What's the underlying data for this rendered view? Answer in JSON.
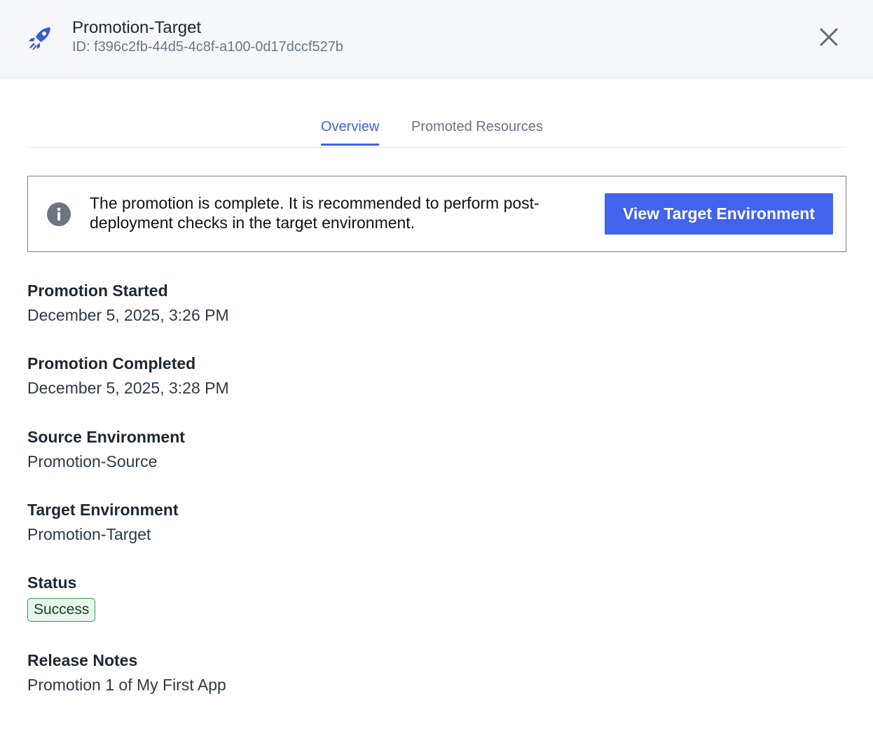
{
  "header": {
    "title": "Promotion-Target",
    "id_text": "ID: f396c2fb-44d5-4c8f-a100-0d17dccf527b",
    "icon": "rocket-icon",
    "close_icon": "close-icon",
    "accent_color": "#3f63e0"
  },
  "tabs": [
    {
      "label": "Overview",
      "active": true
    },
    {
      "label": "Promoted Resources",
      "active": false
    }
  ],
  "notice": {
    "icon": "info-icon",
    "message": "The promotion is complete. It is recommended to perform post-deployment checks in the target environment.",
    "button_label": "View Target Environment",
    "button_color": "#4263eb"
  },
  "details": {
    "promotion_started": {
      "label": "Promotion Started",
      "value": "December 5, 2025, 3:26 PM"
    },
    "promotion_completed": {
      "label": "Promotion Completed",
      "value": "December 5, 2025, 3:28 PM"
    },
    "source_environment": {
      "label": "Source Environment",
      "value": "Promotion-Source"
    },
    "target_environment": {
      "label": "Target Environment",
      "value": "Promotion-Target"
    },
    "status": {
      "label": "Status",
      "value": "Success",
      "color": "#2e9e4b"
    },
    "release_notes": {
      "label": "Release Notes",
      "value": "Promotion 1 of My First App"
    }
  }
}
